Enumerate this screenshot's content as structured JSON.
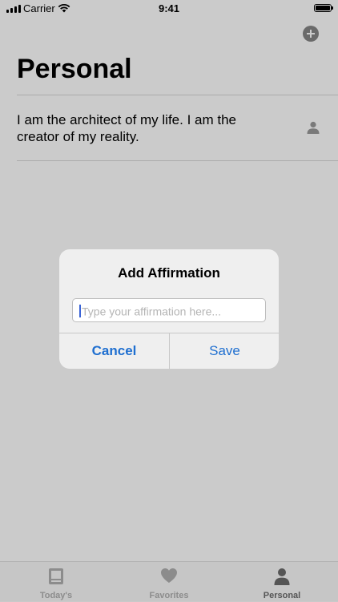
{
  "status_bar": {
    "carrier": "Carrier",
    "time": "9:41"
  },
  "header": {
    "title": "Personal",
    "add_icon": "plus-circle-icon"
  },
  "affirmations": [
    {
      "text": "I am the architect of my life. I am the creator of my reality.",
      "icon": "person-icon"
    }
  ],
  "alert": {
    "title": "Add Affirmation",
    "input_placeholder": "Type your affirmation here...",
    "input_value": "",
    "cancel_label": "Cancel",
    "save_label": "Save",
    "accent_color": "#1f6fd0"
  },
  "tab_bar": {
    "tabs": [
      {
        "label": "Today's",
        "icon": "book-icon",
        "active": false
      },
      {
        "label": "Favorites",
        "icon": "heart-icon",
        "active": false
      },
      {
        "label": "Personal",
        "icon": "person-icon",
        "active": true
      }
    ]
  }
}
